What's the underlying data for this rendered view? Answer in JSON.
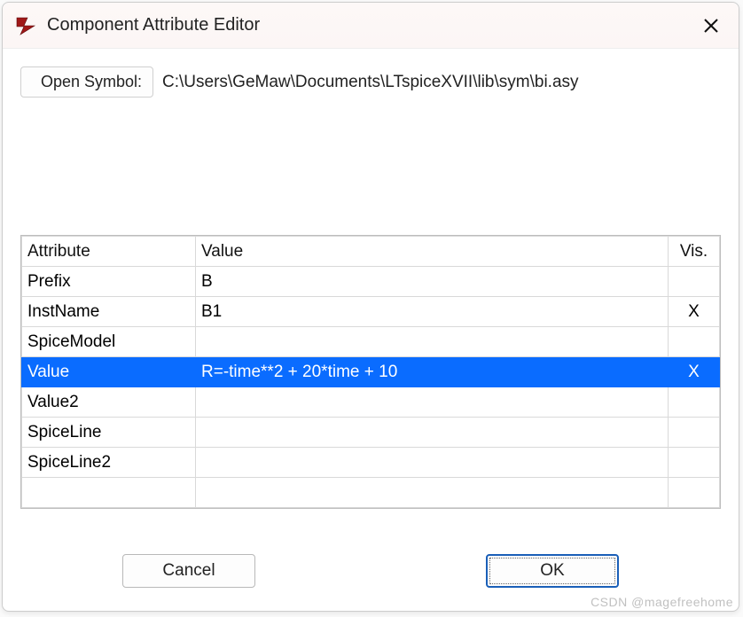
{
  "window": {
    "title": "Component Attribute Editor"
  },
  "openSymbol": {
    "buttonLabel": "Open Symbol:",
    "path": "C:\\Users\\GeMaw\\Documents\\LTspiceXVII\\lib\\sym\\bi.asy"
  },
  "table": {
    "headers": {
      "attribute": "Attribute",
      "value": "Value",
      "vis": "Vis."
    },
    "rows": [
      {
        "attribute": "Prefix",
        "value": "B",
        "vis": "",
        "selected": false
      },
      {
        "attribute": "InstName",
        "value": "B1",
        "vis": "X",
        "selected": false
      },
      {
        "attribute": "SpiceModel",
        "value": "",
        "vis": "",
        "selected": false
      },
      {
        "attribute": "Value",
        "value": "R=-time**2 + 20*time + 10",
        "vis": "X",
        "selected": true
      },
      {
        "attribute": "Value2",
        "value": "",
        "vis": "",
        "selected": false
      },
      {
        "attribute": "SpiceLine",
        "value": "",
        "vis": "",
        "selected": false
      },
      {
        "attribute": "SpiceLine2",
        "value": "",
        "vis": "",
        "selected": false
      },
      {
        "attribute": "",
        "value": "",
        "vis": "",
        "selected": false
      }
    ]
  },
  "buttons": {
    "cancel": "Cancel",
    "ok": "OK"
  },
  "watermark": "CSDN @magefreehome"
}
